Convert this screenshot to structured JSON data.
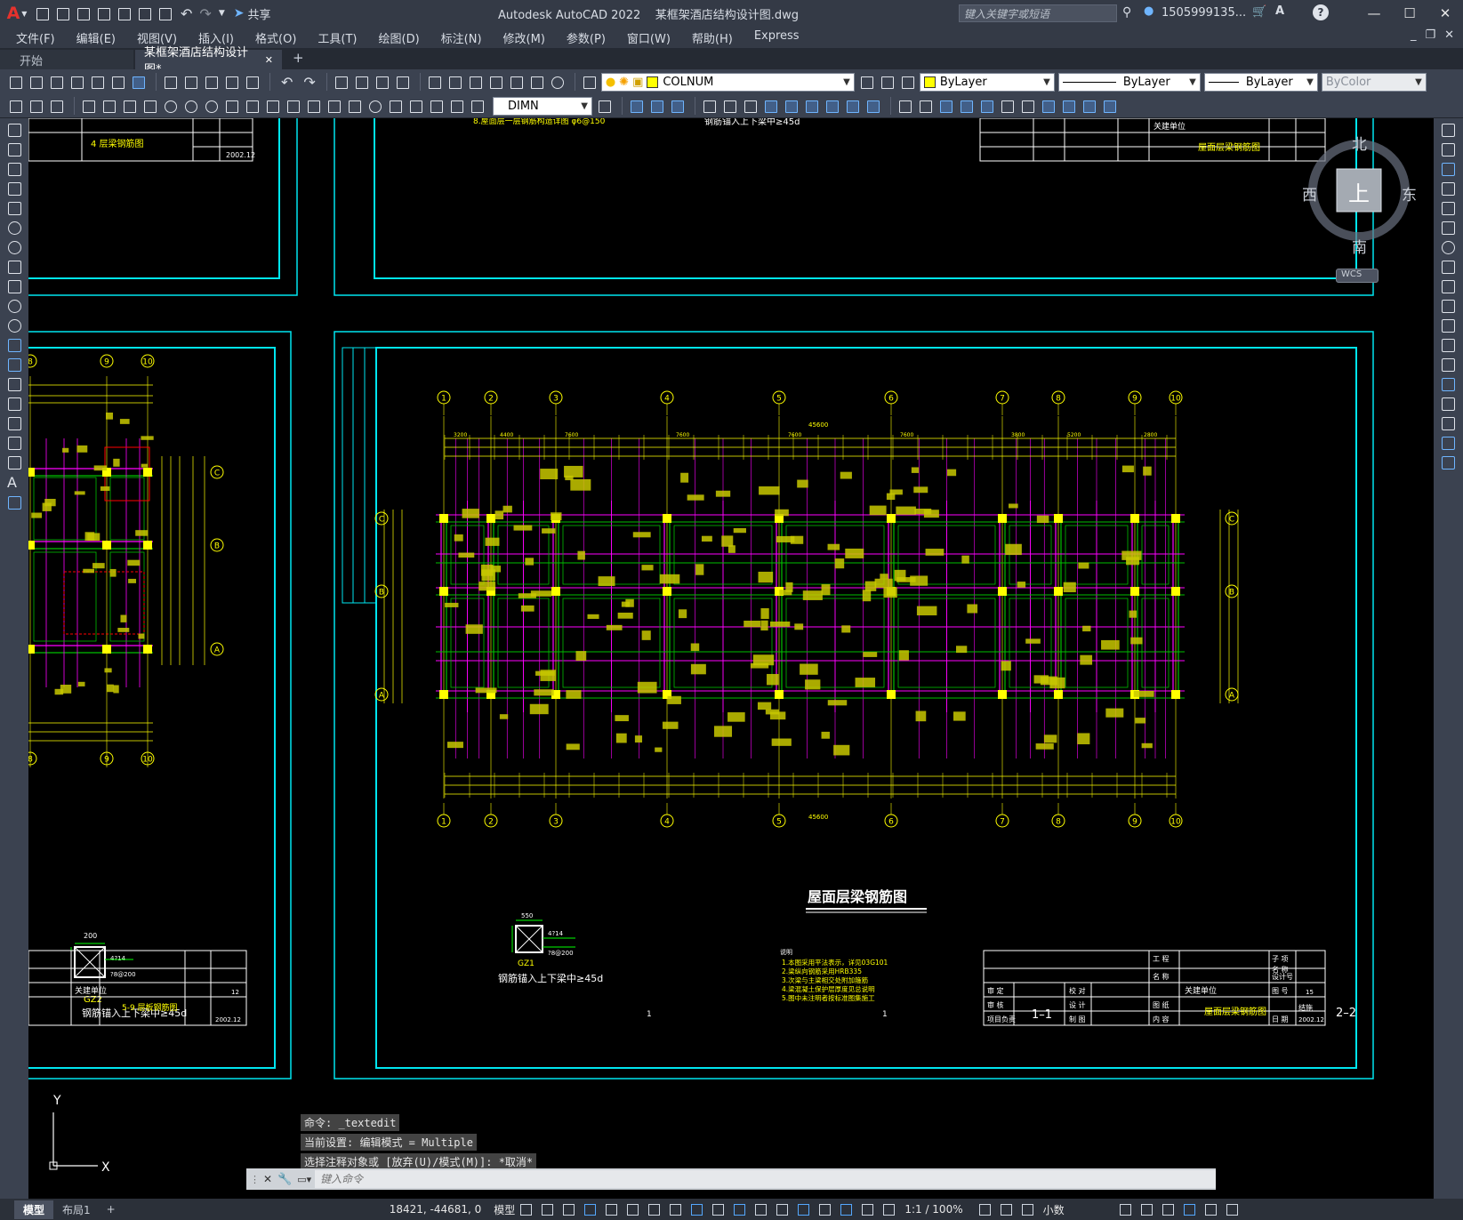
{
  "title_bar": {
    "app_logo": "A",
    "share_label": "共享",
    "title": "Autodesk AutoCAD 2022    某框架酒店结构设计图.dwg",
    "search_placeholder": "键入关键字或短语",
    "user": "1505999135...",
    "help": "?",
    "min": "—",
    "max": "☐",
    "close": "✕"
  },
  "menu": [
    "文件(F)",
    "编辑(E)",
    "视图(V)",
    "插入(I)",
    "格式(O)",
    "工具(T)",
    "绘图(D)",
    "标注(N)",
    "修改(M)",
    "参数(P)",
    "窗口(W)",
    "帮助(H)",
    "Express"
  ],
  "menu_right": {
    "min": "_",
    "restore": "❐",
    "close": "✕"
  },
  "tabs": [
    {
      "label": "开始"
    },
    {
      "label": "某框架酒店结构设计图*",
      "close": "✕"
    }
  ],
  "tab_add": "+",
  "toolbar1": {
    "layer": "COLNUM",
    "color": "ByLayer",
    "linetype": "ByLayer",
    "lineweight": "ByLayer",
    "plotstyle": "ByColor"
  },
  "toolbar2": {
    "dimstyle": "DIMN"
  },
  "viewcube": {
    "n": "北",
    "s": "南",
    "w": "西",
    "e": "东",
    "top": "上",
    "wcs": "WCS"
  },
  "ucs": {
    "x": "X",
    "y": "Y"
  },
  "drawing": {
    "main_title": "屋面层梁钢筋图",
    "axes": [
      "1",
      "2",
      "3",
      "4",
      "5",
      "6",
      "7",
      "8",
      "9",
      "10"
    ],
    "rows": [
      "C",
      "B",
      "A"
    ],
    "left_axes": [
      "8",
      "9",
      "10"
    ],
    "total_dim": "45600",
    "top_dims": [
      "3200",
      "4400",
      "7600",
      "7600",
      "7600",
      "7600",
      "3800",
      "5200",
      "2800"
    ],
    "left_col_note": "钢筋锚入上下梁中≥45d",
    "left_col_name": "GZ2",
    "left_col_size": "200",
    "left_col_rebar": "4?14",
    "left_col_stirrup": "?8@200",
    "right_col_note": "钢筋锚入上下梁中≥45d",
    "right_col_name": "GZ1",
    "right_col_size": "550",
    "right_col_rebar": "4?14",
    "right_col_stirrup": "?8@200",
    "notes_title": "说明",
    "notes": [
      "1.本图采用平法表示，详见03G101",
      "2.梁纵向钢筋采用HRB335",
      "3.次梁与主梁相交处附加箍筋",
      "4.梁混凝土保护层厚度见总说明",
      "5.图中未注明者按标准图集施工"
    ],
    "section_1": "1–1",
    "section_2": "2–2",
    "mark_1a": "1",
    "mark_1b": "1",
    "tb_top_left": "4 层梁钢筋图",
    "tb_top_left_date": "2002.12",
    "tb_top_right": "屋面层梁钢筋图",
    "tb_top_right_dept": "关建单位",
    "top_center_note": "钢筋锚入上下梁中≥45d",
    "top_left_note": "8.屋面层一层钢筋构造详图 φ6@150",
    "tb_left": "5-9 层板钢筋图",
    "tb_left_dept": "关建单位",
    "tb_left_date": "2002.12",
    "tb_left_sheet": "12",
    "tb_right": "屋面层梁钢筋图",
    "tb_right_dept": "关建单位",
    "tb_right_date": "2002.12",
    "tb_right_sheet": "15",
    "tb_labels": [
      "工 程",
      "名 称",
      "审 定",
      "校 对",
      "审 核",
      "设 计",
      "项目负责",
      "制 图",
      "图 纸",
      "内 容",
      "设计号",
      "图 号",
      "日 期",
      "子 项",
      "名 称",
      "结施"
    ]
  },
  "command": {
    "history": [
      "命令: _textedit",
      "当前设置: 编辑模式 = Multiple",
      "选择注释对象或 [放弃(U)/模式(M)]: *取消*"
    ],
    "placeholder": "键入命令"
  },
  "status": {
    "tabs": [
      "模型",
      "布局1"
    ],
    "add": "+",
    "coords": "18421, -44681, 0",
    "space": "模型",
    "scale": "1:1 / 100%",
    "units": "小数"
  }
}
